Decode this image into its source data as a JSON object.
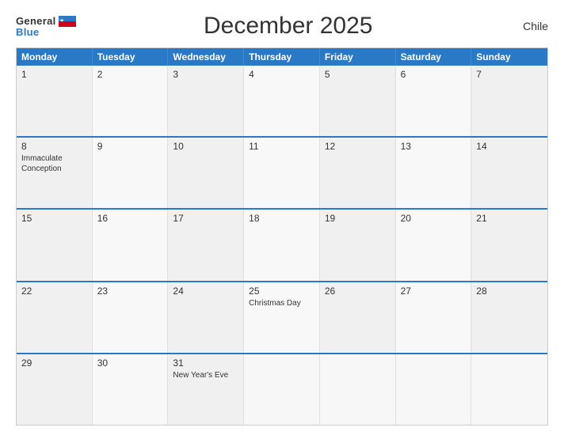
{
  "header": {
    "title": "December 2025",
    "country": "Chile",
    "logo_general": "General",
    "logo_blue": "Blue"
  },
  "weekdays": [
    "Monday",
    "Tuesday",
    "Wednesday",
    "Thursday",
    "Friday",
    "Saturday",
    "Sunday"
  ],
  "weeks": [
    [
      {
        "day": "1",
        "event": ""
      },
      {
        "day": "2",
        "event": ""
      },
      {
        "day": "3",
        "event": ""
      },
      {
        "day": "4",
        "event": ""
      },
      {
        "day": "5",
        "event": ""
      },
      {
        "day": "6",
        "event": ""
      },
      {
        "day": "7",
        "event": ""
      }
    ],
    [
      {
        "day": "8",
        "event": "Immaculate Conception"
      },
      {
        "day": "9",
        "event": ""
      },
      {
        "day": "10",
        "event": ""
      },
      {
        "day": "11",
        "event": ""
      },
      {
        "day": "12",
        "event": ""
      },
      {
        "day": "13",
        "event": ""
      },
      {
        "day": "14",
        "event": ""
      }
    ],
    [
      {
        "day": "15",
        "event": ""
      },
      {
        "day": "16",
        "event": ""
      },
      {
        "day": "17",
        "event": ""
      },
      {
        "day": "18",
        "event": ""
      },
      {
        "day": "19",
        "event": ""
      },
      {
        "day": "20",
        "event": ""
      },
      {
        "day": "21",
        "event": ""
      }
    ],
    [
      {
        "day": "22",
        "event": ""
      },
      {
        "day": "23",
        "event": ""
      },
      {
        "day": "24",
        "event": ""
      },
      {
        "day": "25",
        "event": "Christmas Day"
      },
      {
        "day": "26",
        "event": ""
      },
      {
        "day": "27",
        "event": ""
      },
      {
        "day": "28",
        "event": ""
      }
    ],
    [
      {
        "day": "29",
        "event": ""
      },
      {
        "day": "30",
        "event": ""
      },
      {
        "day": "31",
        "event": "New Year's Eve"
      },
      {
        "day": "",
        "event": ""
      },
      {
        "day": "",
        "event": ""
      },
      {
        "day": "",
        "event": ""
      },
      {
        "day": "",
        "event": ""
      }
    ]
  ]
}
